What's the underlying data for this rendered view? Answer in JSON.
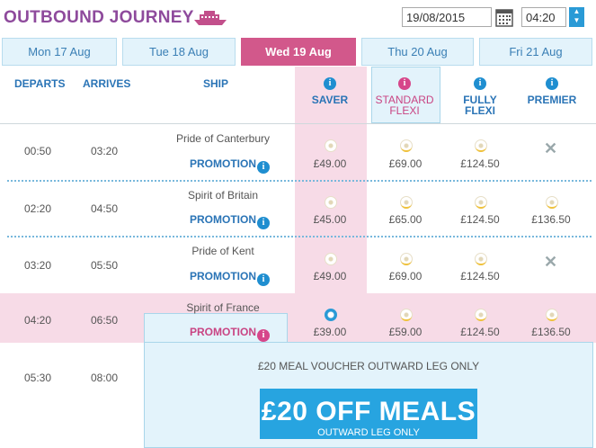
{
  "header": {
    "title": "OUTBOUND JOURNEY",
    "date": "19/08/2015",
    "time": "04:20"
  },
  "tabs": [
    {
      "label": "Mon 17 Aug"
    },
    {
      "label": "Tue 18 Aug"
    },
    {
      "label": "Wed 19 Aug",
      "active": true
    },
    {
      "label": "Thu 20 Aug"
    },
    {
      "label": "Fri 21 Aug"
    }
  ],
  "columns": {
    "departs": "DEPARTS",
    "arrives": "ARRIVES",
    "ship": "SHIP",
    "fares": [
      {
        "line1": "SAVER",
        "line2": ""
      },
      {
        "line1": "STANDARD",
        "line2": "FLEXI"
      },
      {
        "line1": "FULLY",
        "line2": "FLEXI"
      },
      {
        "line1": "PREMIER",
        "line2": ""
      }
    ]
  },
  "rows": [
    {
      "departs": "00:50",
      "arrives": "03:20",
      "ship": "Pride of Canterbury",
      "promo": "PROMOTION",
      "prices": [
        "£49.00",
        "£69.00",
        "£124.50",
        ""
      ]
    },
    {
      "departs": "02:20",
      "arrives": "04:50",
      "ship": "Spirit of Britain",
      "promo": "PROMOTION",
      "prices": [
        "£45.00",
        "£65.00",
        "£124.50",
        "£136.50"
      ]
    },
    {
      "departs": "03:20",
      "arrives": "05:50",
      "ship": "Pride of Kent",
      "promo": "PROMOTION",
      "prices": [
        "£49.00",
        "£69.00",
        "£124.50",
        ""
      ]
    },
    {
      "departs": "04:20",
      "arrives": "06:50",
      "ship": "Spirit of France",
      "promo": "PROMOTION",
      "prices": [
        "£39.00",
        "£59.00",
        "£124.50",
        "£136.50"
      ]
    },
    {
      "departs": "05:30",
      "arrives": "08:00"
    }
  ],
  "popup": {
    "title": "£20 MEAL VOUCHER OUTWARD LEG ONLY",
    "banner_main": "£20 OFF MEALS",
    "banner_sub": "OUTWARD LEG ONLY"
  },
  "colors": {
    "accent": "#d2588b",
    "brand": "#8e4a9c",
    "link": "#2a74b6",
    "info": "#1f8ed0"
  }
}
